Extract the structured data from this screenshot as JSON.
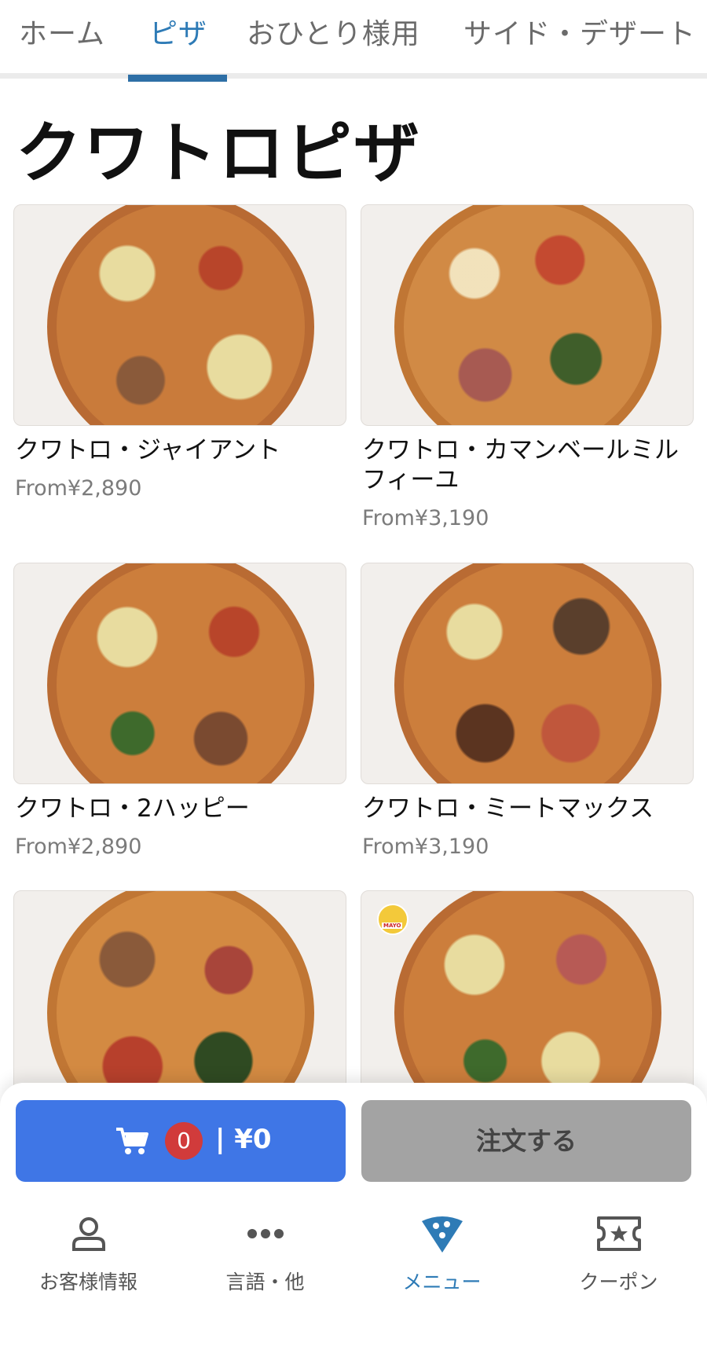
{
  "tabs": [
    {
      "label": "ホーム",
      "active": false
    },
    {
      "label": "ピザ",
      "active": true
    },
    {
      "label": "おひとり様用",
      "active": false
    },
    {
      "label": "サイド・デザート",
      "active": false
    }
  ],
  "page_title": "クワトロピザ",
  "products": [
    {
      "name": "クワトロ・ジャイアント",
      "price": "From¥2,890"
    },
    {
      "name": "クワトロ・カマンベールミルフィーユ",
      "price": "From¥3,190"
    },
    {
      "name": "クワトロ・2ハッピー",
      "price": "From¥2,890"
    },
    {
      "name": "クワトロ・ミートマックス",
      "price": "From¥3,190"
    },
    {
      "name": "",
      "price": ""
    },
    {
      "name": "",
      "price": ""
    }
  ],
  "mayo_badge": "MAYO",
  "cart": {
    "count": "0",
    "total": "| ¥0"
  },
  "order_button": "注文する",
  "bottom_nav": [
    {
      "label": "お客様情報",
      "icon": "person-icon",
      "active": false
    },
    {
      "label": "言語・他",
      "icon": "more-icon",
      "active": false
    },
    {
      "label": "メニュー",
      "icon": "pizza-slice-icon",
      "active": true
    },
    {
      "label": "クーポン",
      "icon": "coupon-ticket-icon",
      "active": false
    }
  ],
  "colors": {
    "accent": "#2e7bb6",
    "cart_button": "#3f76e6",
    "badge": "#d13b3b",
    "order_disabled": "#a3a3a3"
  }
}
